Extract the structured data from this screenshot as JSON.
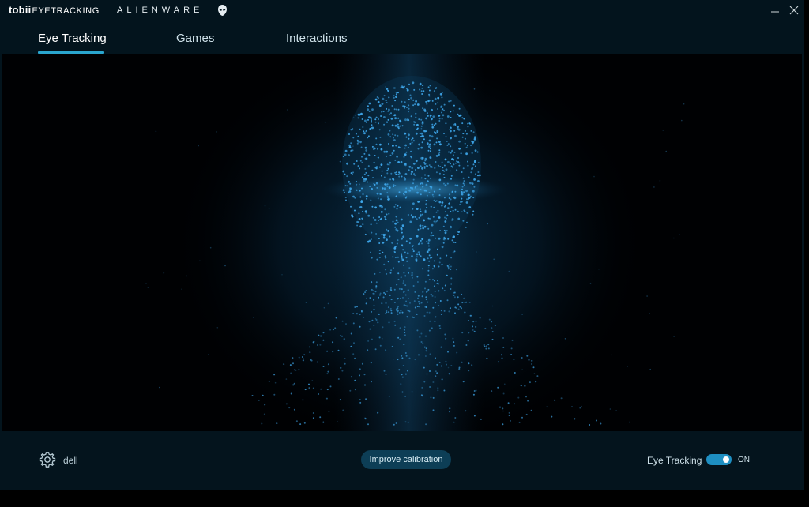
{
  "titlebar": {
    "brand_tobii": "tobii",
    "brand_tobii_sub": "EYETRACKING",
    "brand_alienware": "ALIENWARE",
    "minimize_icon": "minimize-icon",
    "close_icon": "close-icon"
  },
  "tabs": [
    {
      "label": "Eye Tracking",
      "active": true
    },
    {
      "label": "Games",
      "active": false
    },
    {
      "label": "Interactions",
      "active": false
    }
  ],
  "bottom": {
    "settings_icon": "gear-icon",
    "profile_name": "dell",
    "calibration_button": "Improve calibration",
    "eye_tracking_label": "Eye Tracking",
    "toggle_state": "ON",
    "toggle_on": true
  },
  "colors": {
    "window_bg": "#03141d",
    "viewport_bg": "#000103",
    "accent": "#2aa6cf",
    "toggle_on": "#1e8fc2",
    "particle": "#3fa8ec",
    "button_bg": "#0d3e56"
  }
}
